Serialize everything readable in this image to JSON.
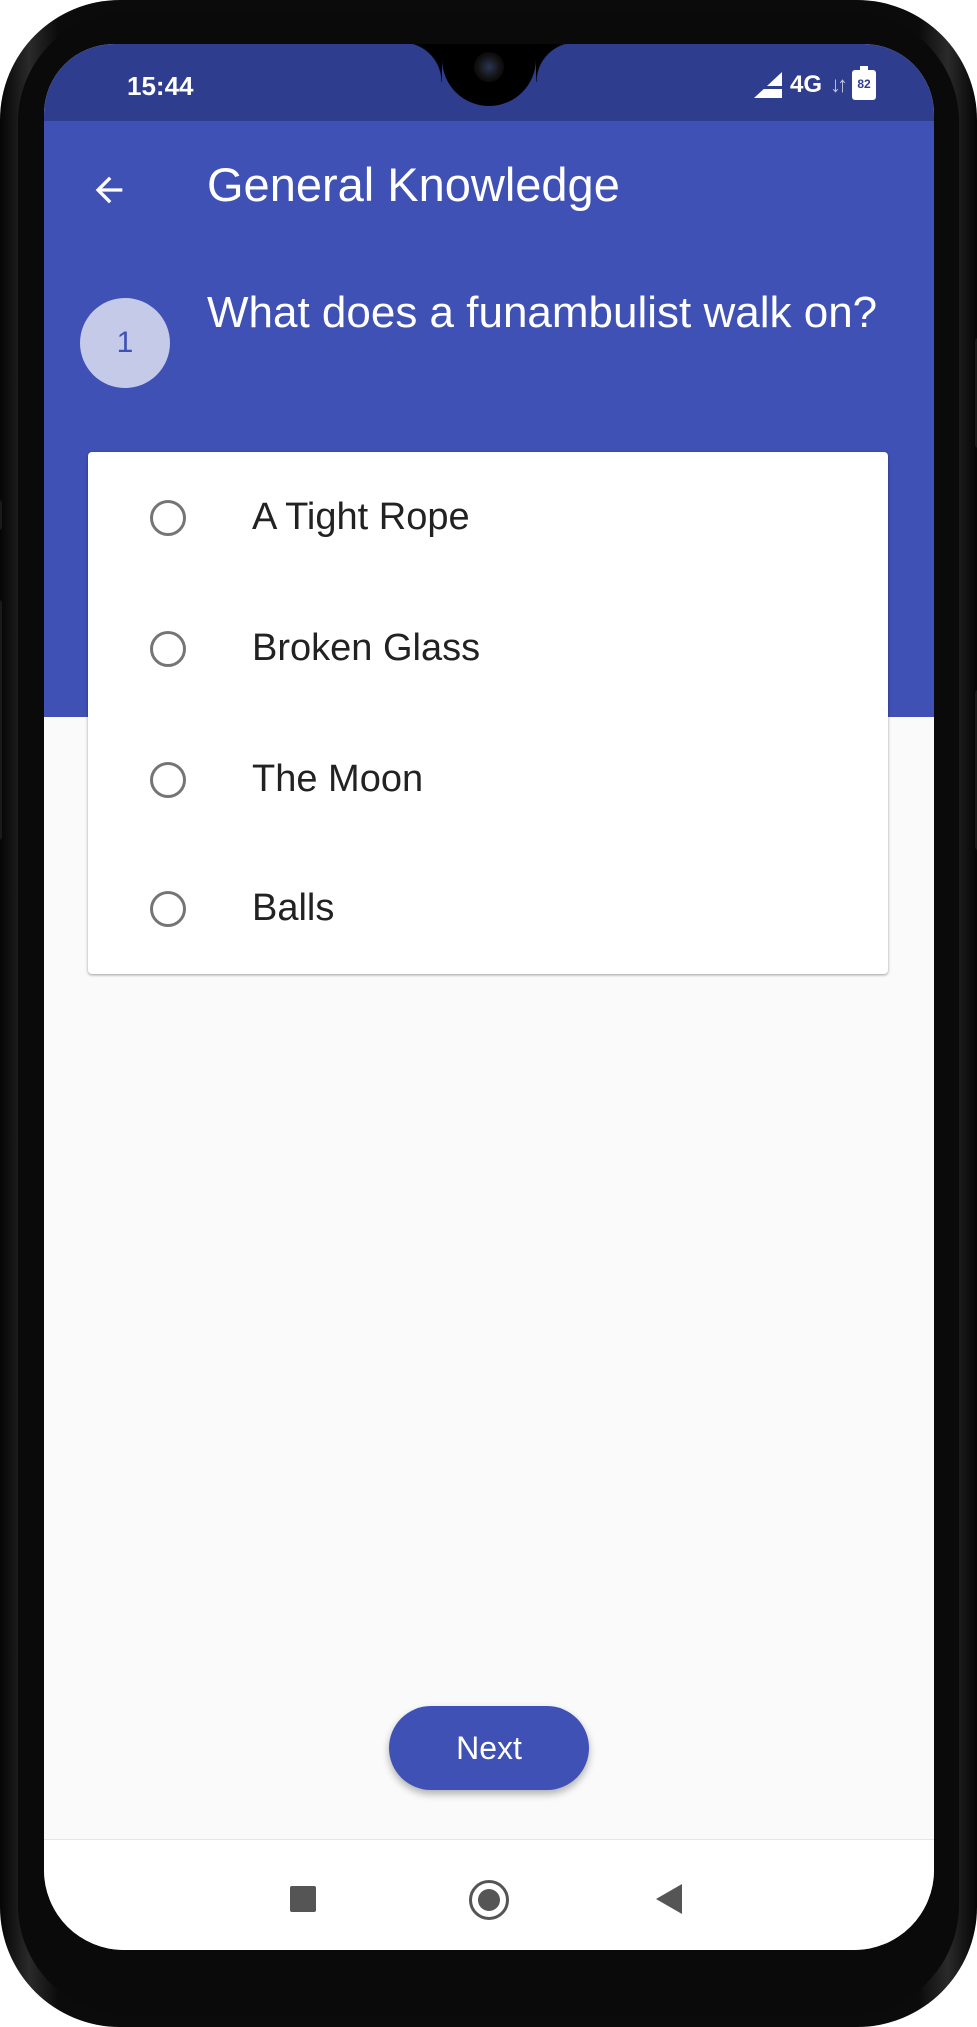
{
  "status_bar": {
    "time": "15:44",
    "network": "4G",
    "battery": "82"
  },
  "toolbar": {
    "back_icon": "arrow-left-icon",
    "title": "General Knowledge"
  },
  "question": {
    "number": "1",
    "text": "What does a funambulist walk on?"
  },
  "options": [
    {
      "label": "A Tight Rope",
      "selected": false
    },
    {
      "label": "Broken Glass",
      "selected": false
    },
    {
      "label": "The Moon",
      "selected": false
    },
    {
      "label": "Balls",
      "selected": false
    }
  ],
  "actions": {
    "next_label": "Next"
  },
  "nav_bar": {
    "icons": [
      "recents-icon",
      "home-icon",
      "back-triangle-icon"
    ]
  },
  "colors": {
    "primary": "#3f51b5",
    "primary_dark": "#2f3d8e",
    "question_badge": "#c5cae9",
    "background": "#fafafa"
  }
}
